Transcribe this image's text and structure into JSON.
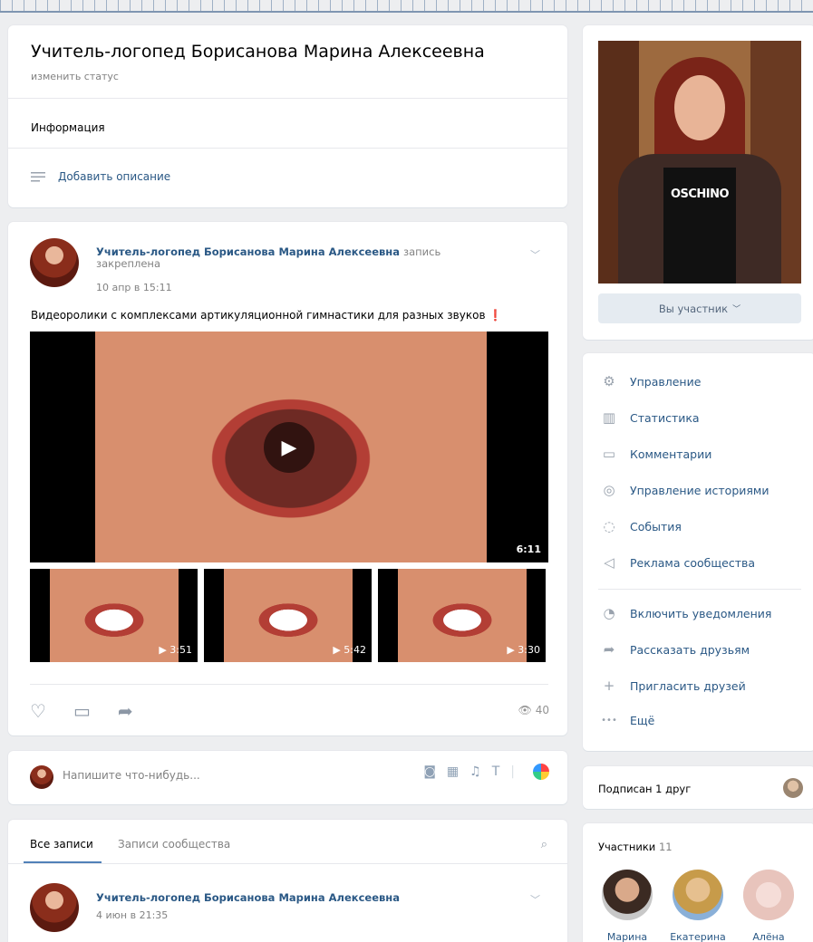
{
  "group": {
    "title": "Учитель-логопед Борисанова Марина Алексеевна",
    "status_link": "изменить статус",
    "info_label": "Информация",
    "add_description": "Добавить описание"
  },
  "pinned_post": {
    "author": "Учитель-логопед Борисанова Марина Алексеевна",
    "pinned_note": "запись закреплена",
    "date": "10 апр в 15:11",
    "text": "Видеоролики с комплексами артикуляционной гимнастики для разных звуков",
    "main_video_duration": "6:11",
    "thumb_durations": [
      "▶ 3:51",
      "▶ 5:42",
      "▶ 3:30"
    ],
    "views": "40"
  },
  "composer": {
    "placeholder": "Напишите что-нибудь..."
  },
  "wall": {
    "tabs": [
      "Все записи",
      "Записи сообщества"
    ],
    "post2_author": "Учитель-логопед Борисанова Марина Алексеевна",
    "post2_date": "4 июн в 21:35"
  },
  "sidebar": {
    "photo_text": "OSCHINO",
    "member_button": "Вы участник",
    "menu": [
      {
        "icon": "⚙",
        "label": "Управление"
      },
      {
        "icon": "▥",
        "label": "Статистика"
      },
      {
        "icon": "▭",
        "label": "Комментарии"
      },
      {
        "icon": "◎",
        "label": "Управление историями"
      },
      {
        "icon": "◌",
        "label": "События"
      },
      {
        "icon": "◁",
        "label": "Реклама сообщества"
      },
      {
        "icon": "♫",
        "label": "Включить уведомления"
      },
      {
        "icon": "➦",
        "label": "Рассказать друзьям"
      },
      {
        "icon": "+",
        "label": "Пригласить друзей"
      },
      {
        "icon": "•••",
        "label": "Ещё"
      }
    ],
    "friends_subscribed": "Подписан 1 друг",
    "members_title": "Участники",
    "members_count": "11",
    "members": [
      "Марина",
      "Екатерина",
      "Алёна"
    ]
  },
  "colors": {
    "link": "#2a5885",
    "page_bg": "#edeef0",
    "accent": "#5181b8"
  }
}
